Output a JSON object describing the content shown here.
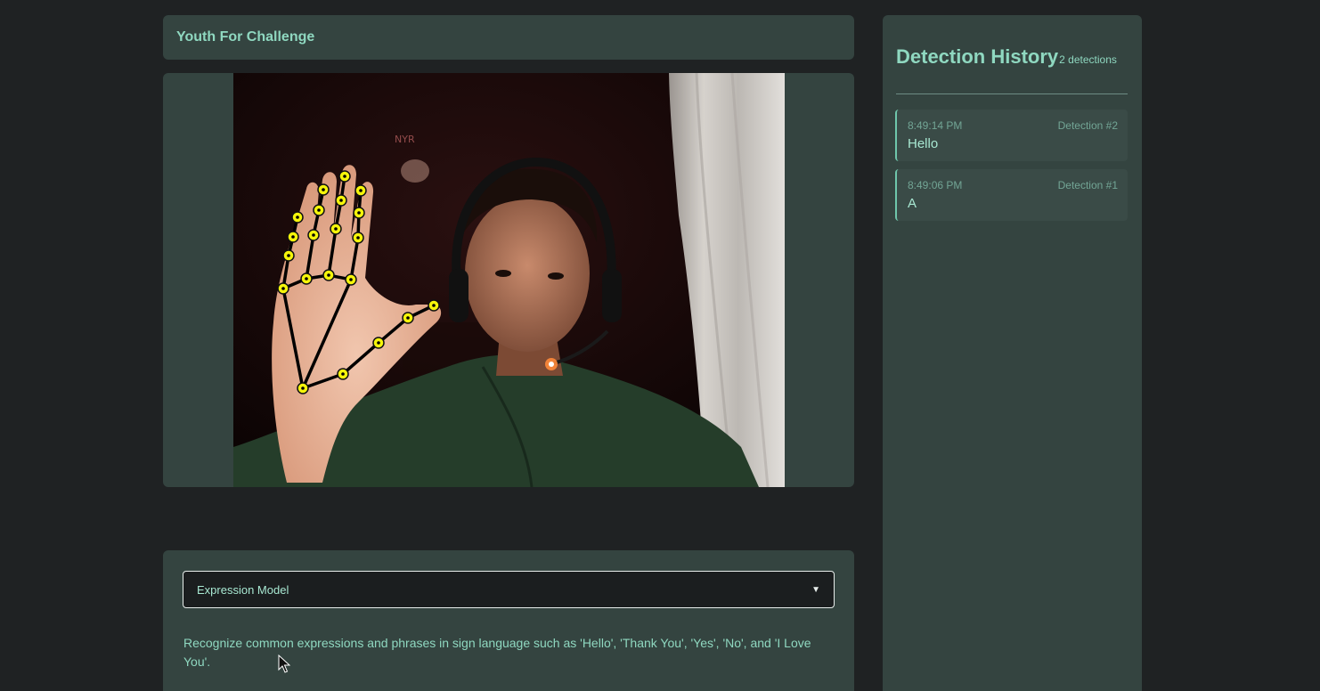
{
  "header": {
    "title": "Youth For Challenge"
  },
  "video": {
    "poster_text": "NYR"
  },
  "controls": {
    "model_select_value": "Expression Model",
    "model_description": "Recognize common expressions and phrases in sign language such as 'Hello', 'Thank You', 'Yes', 'No', and 'I Love You'."
  },
  "history": {
    "title": "Detection History",
    "count_label": "2 detections",
    "items": [
      {
        "time": "8:49:14 PM",
        "number": "Detection #2",
        "label": "Hello"
      },
      {
        "time": "8:49:06 PM",
        "number": "Detection #1",
        "label": "A"
      }
    ]
  },
  "colors": {
    "page_bg": "#1f2223",
    "card_bg": "#344440",
    "accent_text": "#8fd8c0",
    "landmark_color": "#f5f50a"
  },
  "icons": {
    "dropdown": "chevron-down-icon",
    "cursor": "mouse-pointer-icon"
  }
}
